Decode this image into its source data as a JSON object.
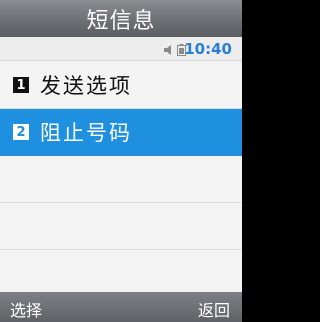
{
  "title": "短信息",
  "status": {
    "time": "10:40",
    "icons": [
      "speaker-icon",
      "battery-icon"
    ]
  },
  "menu": {
    "items": [
      {
        "number": "1",
        "label": "发送选项",
        "selected": false
      },
      {
        "number": "2",
        "label": "阻止号码",
        "selected": true
      }
    ]
  },
  "softkeys": {
    "left": "选择",
    "right": "返回"
  },
  "colors": {
    "selection": "#1f8fe0",
    "time": "#2a7fd0"
  }
}
